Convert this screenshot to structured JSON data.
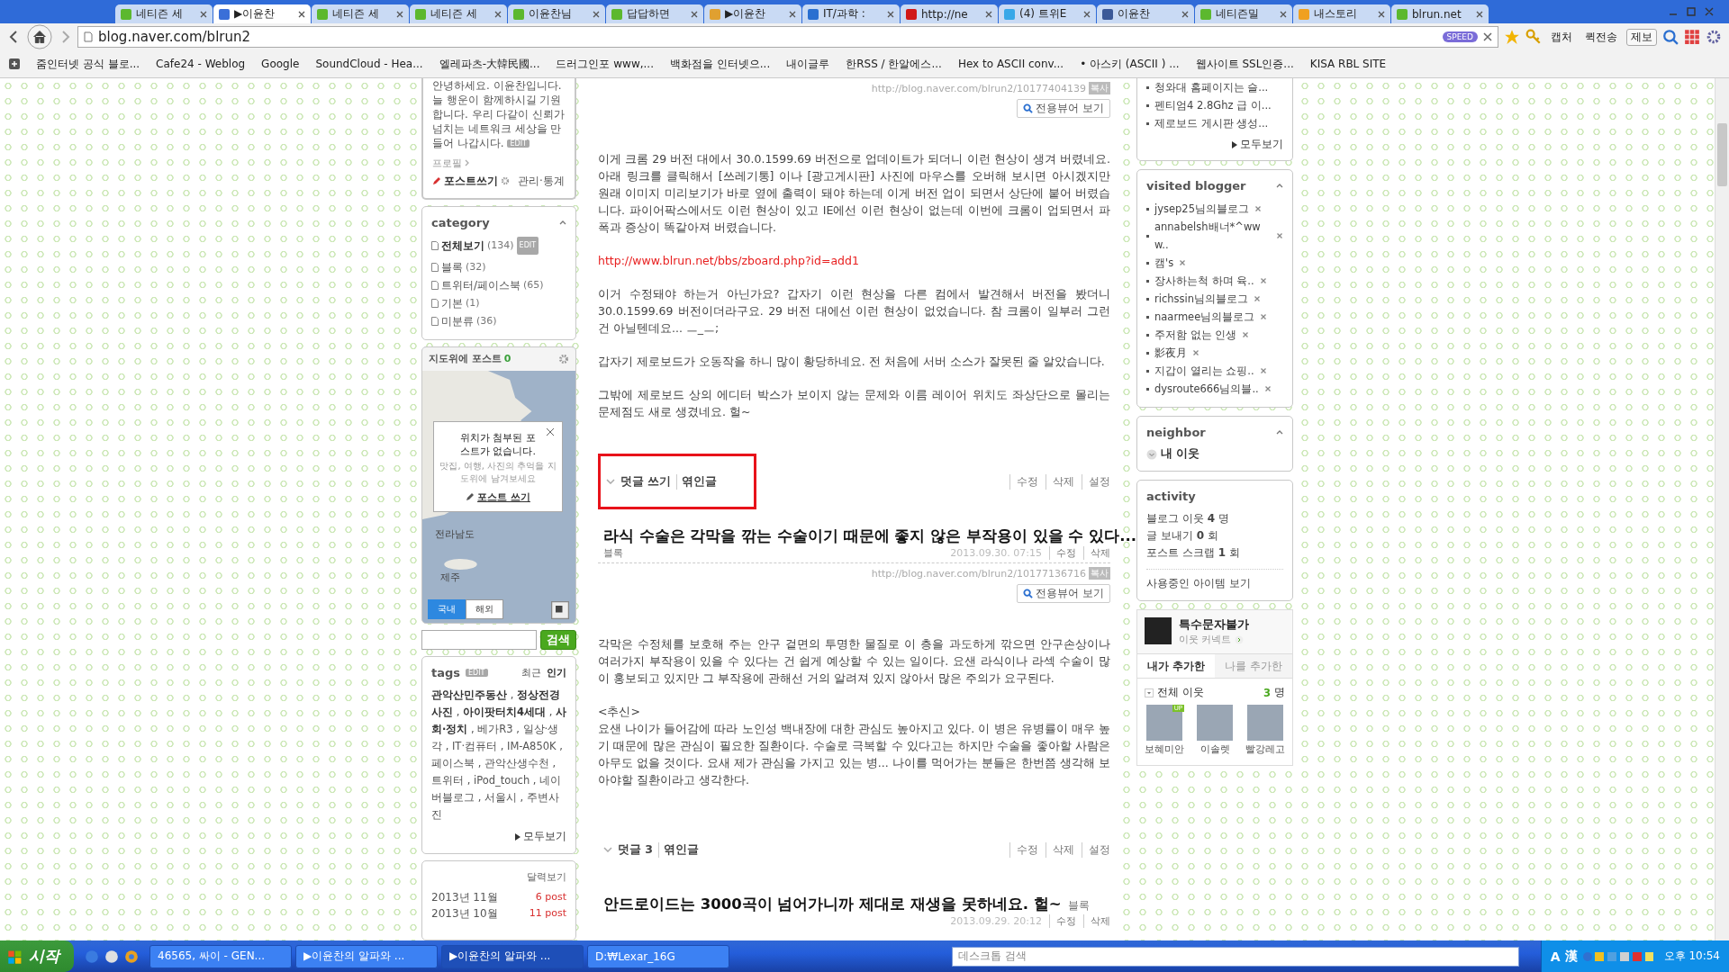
{
  "tabs": [
    {
      "title": "네티즌 세",
      "selected": false,
      "color": "#5cb82e"
    },
    {
      "title": "▶이윤찬",
      "selected": true,
      "color": "#3a6fd8"
    },
    {
      "title": "네티즌 세",
      "selected": false,
      "color": "#5cb82e"
    },
    {
      "title": "네티즌 세",
      "selected": false,
      "color": "#5cb82e"
    },
    {
      "title": "이윤찬님",
      "selected": false,
      "color": "#5cb82e"
    },
    {
      "title": "답답하면",
      "selected": false,
      "color": "#5cb82e"
    },
    {
      "title": "▶이윤찬",
      "selected": false,
      "color": "#e0a030"
    },
    {
      "title": "IT/과학 :",
      "selected": false,
      "color": "#2a6fd0"
    },
    {
      "title": "http://ne",
      "selected": false,
      "color": "#d01818"
    },
    {
      "title": "(4) 트위E",
      "selected": false,
      "color": "#38a8e8"
    },
    {
      "title": "이윤찬",
      "selected": false,
      "color": "#3b5998"
    },
    {
      "title": "네티즌밀",
      "selected": false,
      "color": "#5cb82e"
    },
    {
      "title": "내스토리",
      "selected": false,
      "color": "#f0a020"
    },
    {
      "title": "blrun.net",
      "selected": false,
      "color": "#5cb82e"
    }
  ],
  "address_bar": {
    "url": "blog.naver.com/blrun2",
    "badge": "SPEED"
  },
  "toolbar_buttons": [
    {
      "label": "캡처"
    },
    {
      "label": "퀵전송"
    },
    {
      "label": "제보"
    }
  ],
  "bookmarks": [
    "줌인터넷 공식 블로...",
    "Cafe24 - Weblog",
    "Google",
    "SoundCloud - Hea...",
    "엘레파츠-大韓民國...",
    "드러그인포 www,...",
    "백화점을 인터넷으...",
    "내이글루",
    "한RSS / 한알에스...",
    "Hex to ASCII conv...",
    "• 아스키 (ASCII ) ...",
    "웹사이트 SSL인증...",
    "KISA RBL SITE"
  ],
  "profile": {
    "intro": "안녕하세요. 이윤찬입니다. 늘 행운이 함께하시길 기원합니다. 우리 다같이 신뢰가 넘치는 네트워크 세상을 만들어 나갑시다.",
    "edit": "EDIT",
    "profile_link": "프로필",
    "write": "포스트쓰기",
    "manage": "관리·통계"
  },
  "category": {
    "title": "category",
    "items": [
      {
        "label": "전체보기",
        "count": "(134)",
        "edit": "EDIT",
        "kind": "all"
      },
      {
        "label": "블록",
        "count": "(32)",
        "kind": "folder"
      },
      {
        "label": "트위터/페이스북",
        "count": "(65)",
        "kind": "folder"
      },
      {
        "label": "기본",
        "count": "(1)",
        "kind": "folder"
      },
      {
        "label": "미분류",
        "count": "(36)",
        "kind": "folder"
      }
    ]
  },
  "map_widget": {
    "title": "지도위에 포스트",
    "count": "0",
    "popup_title": "위치가 첨부된 포스트가 없습니다.",
    "popup_hint": "맛집, 여행, 사진의 추억을 지도위에 남겨보세요",
    "popup_action": "포스트 쓰기",
    "labels": [
      "전라남도",
      "제주"
    ],
    "tabs": [
      {
        "label": "국내",
        "selected": true
      },
      {
        "label": "해외",
        "selected": false
      }
    ]
  },
  "search": {
    "button": "검색"
  },
  "tags": {
    "title": "tags",
    "edit": "EDIT",
    "sorts": [
      {
        "label": "최근",
        "selected": false
      },
      {
        "label": "인기",
        "selected": true
      }
    ],
    "list": "**관악산민주동산** , **정상전경사진** , **아이팟터치4세대** , **사회·정치** , 베가R3 , 일상·생각 , IT·컴퓨터 , IM-A850K , 페이스북 , 관악산생수천 , 트위터 , iPod_touch , 네이버블로그 , 서울시 , 주변사진",
    "more": "모두보기"
  },
  "calendar": {
    "link": "달력보기",
    "rows": [
      {
        "month": "2013년 11월",
        "count": "6 post"
      },
      {
        "month": "2013년 10월",
        "count": "11 post"
      }
    ]
  },
  "posts": [
    {
      "url": "http://blog.naver.com/blrun2/10177404139",
      "copy": "복사",
      "viewer": "전용뷰어 보기",
      "paragraphs": [
        {
          "kind": "text",
          "text": "이게 크롬 29 버전 대에서 30.0.1599.69 버전으로 업데이트가 되더니 이런 현상이 생겨 버렸네요. 아래 링크를 클릭해서 [쓰레기통] 이나 [광고게시판] 사진에 마우스를 오버해 보시면 아시겠지만 원래 이미지 미리보기가 바로 옆에 출력이 돼야 하는데 이게 버전 업이 되면서 상단에 붙어 버렸습니다. 파이어팍스에서도 이런 현상이 있고 IE에선 이런 현상이 없는데 이번에 크롬이 업되면서 파폭과 증상이 똑같아져 버렸습니다."
        },
        {
          "kind": "link",
          "text": "http://www.blrun.net/bbs/zboard.php?id=add1"
        },
        {
          "kind": "text",
          "text": "이거 수정돼야 하는거 아닌가요? 갑자기 이런 현상을 다른 컴에서 발견해서 버전을 봤더니 30.0.1599.69 버전이더라구요. 29 버전 대에선 이런 현상이 없었습니다. 참 크롬이 일부러 그런 건 아닐텐데요... ㅡ_ㅡ;"
        },
        {
          "kind": "text",
          "text": "갑자기 제로보드가 오동작을 하니 많이 황당하네요. 전 처음에 서버 소스가 잘못된 줄 알았습니다."
        },
        {
          "kind": "text",
          "text": "그밖에 제로보드 상의 에디터 박스가 보이지 않는 문제와 이름 레이어 위치도 좌상단으로 몰리는 문제점도 새로 생겼네요. 헐~"
        }
      ],
      "comments": {
        "label": "덧글 쓰기",
        "trackback": "엮인글",
        "actions": [
          "수정",
          "삭제",
          "설정"
        ],
        "highlighted": true
      }
    },
    {
      "title": "라식 수술은 각막을 깎는 수술이기 때문에 좋지 않은 부작용이 있을 수 있다...",
      "category": "블록",
      "date": "2013.09.30. 07:15",
      "meta_actions": [
        "수정",
        "삭제"
      ],
      "url": "http://blog.naver.com/blrun2/10177136716",
      "copy": "복사",
      "viewer": "전용뷰어 보기",
      "paragraphs": [
        {
          "kind": "text",
          "text": "각막은 수정체를 보호해 주는 안구 겉면의 투명한 물질로 이 층을 과도하게 깎으면 안구손상이나 여러가지 부작용이 있을 수 있다는 건 쉽게 예상할 수 있는 일이다. 요샌 라식이나 라섹 수술이 많이 홍보되고 있지만 그 부작용에 관해선 거의 알려져 있지 않아서 많은 주의가 요구된다."
        },
        {
          "kind": "text",
          "text": "<추신>\n요샌 나이가 들어감에 따라 노인성 백내장에 대한 관심도 높아지고 있다. 이 병은 유병률이 매우 높기 때문에 많은 관심이 필요한 질환이다. 수술로 극복할 수 있다고는 하지만 수술을 좋아할 사람은 아무도 없을 것이다. 요새 제가 관심을 가지고 있는 병... 나이를 먹어가는 분들은 한번쯤 생각해 보아야할 질환이라고 생각한다."
        }
      ],
      "comments": {
        "label": "덧글 3",
        "trackback": "엮인글",
        "actions": [
          "수정",
          "삭제",
          "설정"
        ],
        "highlighted": false
      }
    },
    {
      "title": "안드로이드는 3000곡이 넘어가니까 제대로 재생을 못하네요. 헐~",
      "category": "블록",
      "date": "2013.09.29. 20:12",
      "meta_actions": [
        "수정",
        "삭제"
      ],
      "inline_category": true
    }
  ],
  "recent_posts": {
    "items": [
      "청와대 홈페이지는 슬...",
      "펜티엄4 2.8Ghz 급 이...",
      "제로보드 게시판 생성..."
    ],
    "more": "모두보기"
  },
  "visited_blogger": {
    "title": "visited blogger",
    "items": [
      "jysep25님의블로그",
      "annabelsh배너*^www..",
      "캠's",
      "장사하는척 하며 육..",
      "richssin님의블로그",
      "naarmee님의블로그",
      "주저함 없는 인생",
      "影夜月",
      "지갑이 열리는 쇼핑..",
      "dysroute666님의블.."
    ]
  },
  "neighbor": {
    "title": "neighbor",
    "link": "내 이웃"
  },
  "activity": {
    "title": "activity",
    "lines": [
      "블로그 이웃 **4** 명",
      "글 보내기 **0** 회",
      "포스트 스크랩 **1** 회"
    ],
    "link": "사용중인 아이템 보기"
  },
  "neighbor_connect": {
    "name": "특수문자불가",
    "sub": "이웃 커넥트",
    "tabs": [
      {
        "label": "내가 추가한",
        "selected": true
      },
      {
        "label": "나를 추가한",
        "selected": false
      }
    ],
    "group": "전체 이웃",
    "count": "3",
    "unit": "명",
    "friends": [
      {
        "name": "보혜미안",
        "badge": "UP"
      },
      {
        "name": "이솔렛"
      },
      {
        "name": "빨강레고"
      }
    ]
  },
  "taskbar": {
    "start": "시작",
    "tasks": [
      {
        "label": "46565, 싸이 - GEN...",
        "selected": false
      },
      {
        "label": "▶이윤찬의 알파와 ...",
        "selected": false
      },
      {
        "label": "▶이윤찬의 알파와 ...",
        "selected": true
      },
      {
        "label": "D:₩Lexar_16G",
        "selected": false
      }
    ],
    "search": "데스크톱 검색",
    "ime": [
      "A",
      "漢"
    ],
    "clock": "오후 10:54"
  }
}
